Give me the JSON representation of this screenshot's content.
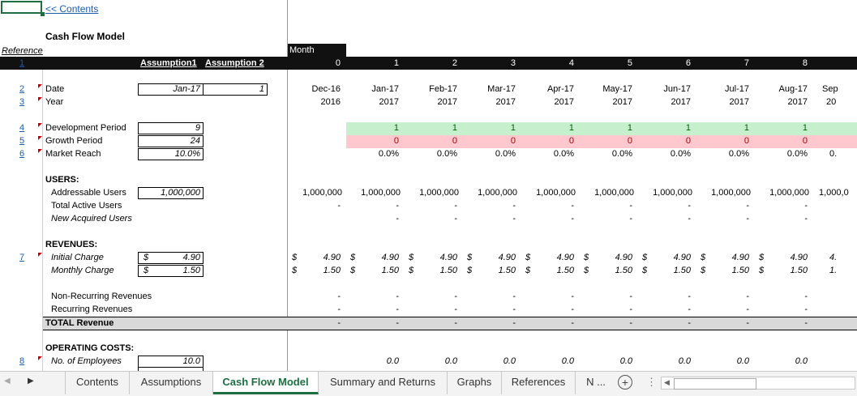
{
  "sheet": {
    "contents_link": "<< Contents",
    "title": "Cash Flow Model",
    "reference_label": "Reference",
    "month_label": "Month",
    "assumption1_header": "Assumption1",
    "assumption2_header": "Assumption 2",
    "months": [
      {
        "num": "0",
        "date": "Dec-16",
        "year": "2016"
      },
      {
        "num": "1",
        "date": "Jan-17",
        "year": "2017"
      },
      {
        "num": "2",
        "date": "Feb-17",
        "year": "2017"
      },
      {
        "num": "3",
        "date": "Mar-17",
        "year": "2017"
      },
      {
        "num": "4",
        "date": "Apr-17",
        "year": "2017"
      },
      {
        "num": "5",
        "date": "May-17",
        "year": "2017"
      },
      {
        "num": "6",
        "date": "Jun-17",
        "year": "2017"
      },
      {
        "num": "7",
        "date": "Jul-17",
        "year": "2017"
      },
      {
        "num": "8",
        "date": "Aug-17",
        "year": "2017"
      },
      {
        "num": "",
        "date": "Sep",
        "year": "20"
      }
    ],
    "refs": [
      "1",
      "2",
      "3",
      "4",
      "5",
      "6",
      "7",
      "8"
    ],
    "labels": {
      "date": "Date",
      "year": "Year",
      "dev_period": "Development Period",
      "growth_period": "Growth Period",
      "market_reach": "Market Reach",
      "users": "USERS:",
      "addressable": "Addressable Users",
      "total_active": "Total Active Users",
      "new_acquired": "New Acquired Users",
      "revenues": "REVENUES:",
      "initial_charge": "Initial Charge",
      "monthly_charge": "Monthly Charge",
      "non_recurring": "Non-Recurring Revenues",
      "recurring": "Recurring Revenues",
      "total_revenue": "TOTAL Revenue",
      "operating_costs": "OPERATING COSTS:",
      "employees": "No. of Employees"
    },
    "assumptions": {
      "date": "Jan-17",
      "date_a2": "1",
      "dev_period": "9",
      "growth_period": "24",
      "market_reach": "10.0%",
      "addressable": "1,000,000",
      "currency": "$",
      "initial_charge": "4.90",
      "monthly_charge": "1.50",
      "employees": "10.0"
    },
    "values": {
      "green": "1",
      "red": "0",
      "pct": "0.0%",
      "addressable": "1,000,000",
      "addressable_partial": "1,000,0",
      "dash": "-",
      "currency": "$",
      "initial": "4.90",
      "monthly": "1.50",
      "emp": "0.0",
      "pct_partial": "0.",
      "initial_partial": "4.",
      "monthly_partial": "1."
    }
  },
  "tabs": {
    "items": [
      "Contents",
      "Assumptions",
      "Cash Flow Model",
      "Summary and Returns",
      "Graphs",
      "References",
      "N ..."
    ],
    "active": "Cash Flow Model"
  },
  "colors": {
    "header_bg": "#111111",
    "green_fill": "#c6efce",
    "green_text": "#006100",
    "red_fill": "#ffc7ce",
    "red_text": "#9c0006",
    "total_fill": "#d9d9d9",
    "link": "#1a5dad",
    "active_tab": "#1e6e42"
  }
}
